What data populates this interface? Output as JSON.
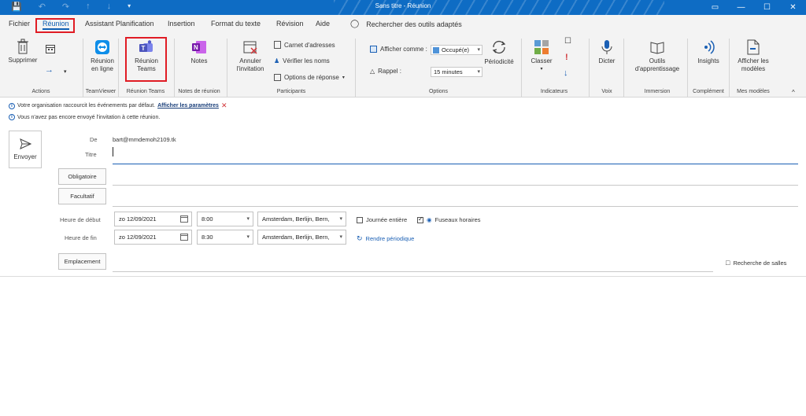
{
  "window": {
    "title": "Sans titre - Réunion",
    "quick_access": [
      "save-icon",
      "undo-icon",
      "redo-icon",
      "up-icon",
      "down-icon",
      "customize-icon"
    ],
    "controls": [
      "ribbon-display-icon",
      "minimize-icon",
      "maximize-icon",
      "close-icon"
    ]
  },
  "tabs": [
    {
      "label": "Fichier"
    },
    {
      "label": "Réunion",
      "active": true
    },
    {
      "label": "Assistant Planification"
    },
    {
      "label": "Insertion"
    },
    {
      "label": "Format du texte"
    },
    {
      "label": "Révision"
    },
    {
      "label": "Aide"
    }
  ],
  "tell_me": "Rechercher des outils adaptés",
  "ribbon": {
    "actions": {
      "label": "Actions",
      "delete": "Supprimer"
    },
    "teamviewer": {
      "label": "TeamViewer",
      "online": "Réunion en ligne"
    },
    "teams": {
      "label": "Réunion Teams",
      "button": "Réunion Teams"
    },
    "notes": {
      "label": "Notes de réunion",
      "button": "Notes"
    },
    "participants": {
      "label": "Participants",
      "cancel": "Annuler l'invitation",
      "address_book": "Carnet d'adresses",
      "check_names": "Vérifier les noms",
      "response_options": "Options de réponse"
    },
    "options": {
      "label": "Options",
      "show_as_label": "Afficher comme :",
      "show_as_value": "Occupé(e)",
      "reminder_label": "Rappel :",
      "reminder_value": "15 minutes",
      "recurrence": "Périodicité"
    },
    "tags": {
      "label": "Indicateurs",
      "categorize": "Classer"
    },
    "voice": {
      "label": "Voix",
      "dictate": "Dicter"
    },
    "immersive": {
      "label": "Immersion",
      "tools": "Outils d'apprentissage"
    },
    "addin": {
      "label": "Complément",
      "insights": "Insights"
    },
    "templates": {
      "label": "Mes modèles",
      "view": "Afficher les modèles"
    }
  },
  "infobar": {
    "line1_text": "Votre organisation raccourcit les événements par défaut.",
    "line1_link": "Afficher les paramètres",
    "line2_text": "Vous n'avez pas encore envoyé l'invitation à cette réunion."
  },
  "form": {
    "send": "Envoyer",
    "from_label": "De",
    "from_value": "bart@mmdemoh2109.tk",
    "title_label": "Titre",
    "required": "Obligatoire",
    "optional": "Facultatif",
    "start_label": "Heure de début",
    "start_date": "zo 12/09/2021",
    "start_time": "8:00",
    "start_tz": "Amsterdam, Berlijn, Bern,",
    "allday": "Journée entière",
    "timezones": "Fuseaux horaires",
    "end_label": "Heure de fin",
    "end_date": "zo 12/09/2021",
    "end_time": "8:30",
    "end_tz": "Amsterdam, Berlijn, Bern,",
    "recurring": "Rendre périodique",
    "location": "Emplacement",
    "room_finder": "Recherche de salles"
  }
}
